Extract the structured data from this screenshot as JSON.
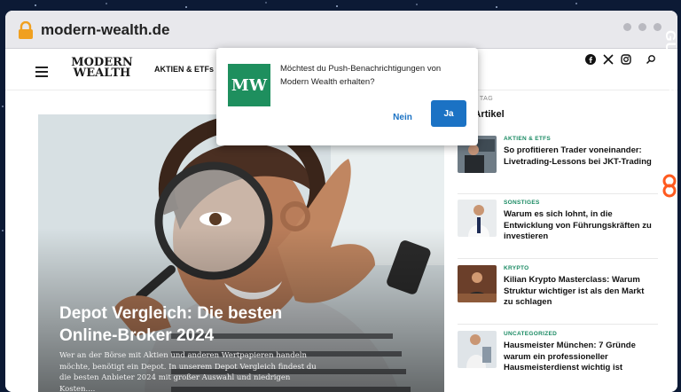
{
  "browser": {
    "url": "modern-wealth.de"
  },
  "site": {
    "logo_line1": "MODERN",
    "logo_line2": "WEALTH",
    "nav_first": "AKTIEN & ETFs"
  },
  "hero": {
    "title": "Depot Vergleich: Die besten Online-Broker 2024",
    "excerpt": "Wer an der Börse mit Aktien und anderen Wertpapieren handeln möchte, benötigt ein Depot. In unserem Depot Vergleich findest du die besten Anbieter 2024 mit großer Auswahl und niedrigen Kosten...."
  },
  "sidebar": {
    "label_fragment": "N TAG",
    "title_fragment": "ue Artikel",
    "articles": [
      {
        "category": "AKTIEN & ETFS",
        "title": "So profitieren Trader voneinander: Livetrading-Lessons bei JKT-Trading"
      },
      {
        "category": "SONSTIGES",
        "title": "Warum es sich lohnt, in die Entwicklung von Führungskräften zu investieren"
      },
      {
        "category": "KRYPTO",
        "title": "Kilian Krypto Masterclass: Warum Struktur wichtiger ist als den Markt zu schlagen"
      },
      {
        "category": "UNCATEGORIZED",
        "title": "Hausmeister München: 7 Gründe warum ein professioneller Hausmeisterdienst wichtig ist"
      }
    ]
  },
  "popup": {
    "logo": "MW",
    "message": "Möchtest du Push-Benachrichtigungen von Modern Wealth erhalten?",
    "no_label": "Nein",
    "yes_label": "Ja"
  },
  "watermark": {
    "text": "GUESTPOSTLINKS"
  },
  "colors": {
    "accent_green": "#1a8a63",
    "button_blue": "#1b72c4",
    "background": "#0c1a35"
  },
  "icons": [
    "lock-icon",
    "hamburger-icon",
    "facebook-icon",
    "x-icon",
    "instagram-icon",
    "search-icon",
    "guestpostlinks-logo-icon"
  ]
}
